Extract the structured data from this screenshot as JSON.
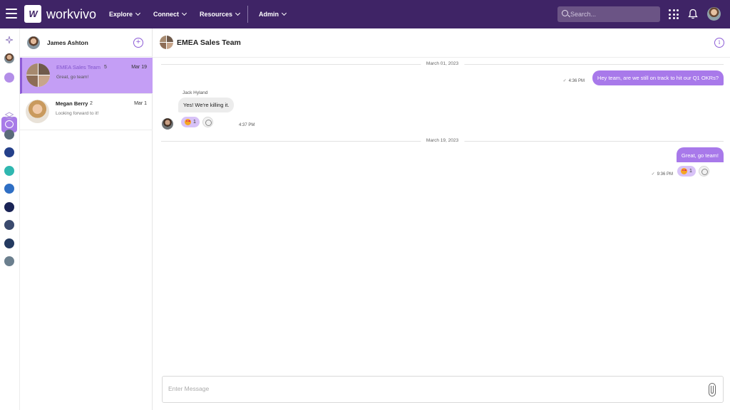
{
  "app": {
    "brand": "workvivo"
  },
  "nav": {
    "items": [
      {
        "label": "Explore"
      },
      {
        "label": "Connect"
      },
      {
        "label": "Resources"
      },
      {
        "label": "Admin"
      }
    ]
  },
  "search": {
    "placeholder": "Search..."
  },
  "colors": {
    "topbar": "#3f2466",
    "accent": "#8c5bd6",
    "active_conversation": "#c49ef5",
    "outgoing_bubble": "#a879ea"
  },
  "icons": {
    "top": [
      "menu-icon",
      "apps-grid-icon",
      "bell-icon"
    ],
    "rail": [
      "sparkle-icon",
      "avatar",
      "compass-icon",
      "chat-icon",
      "layers-icon"
    ]
  },
  "conversations_panel": {
    "user_name": "James Ashton",
    "items": [
      {
        "name": "EMEA Sales Team",
        "count": "5",
        "date": "Mar 19",
        "preview": "Great, go team!",
        "active": true
      },
      {
        "name": "Megan Berry",
        "count": "2",
        "date": "Mar 1",
        "preview": "Looking forward to it!",
        "active": false
      }
    ]
  },
  "chat": {
    "title": "EMEA Sales Team",
    "dates": [
      "March 01, 2023",
      "March 19, 2023"
    ],
    "messages": [
      {
        "direction": "out",
        "text": "Hey team, are we still on track to hit our Q1 OKRs?",
        "time": "4:36 PM"
      },
      {
        "direction": "in",
        "sender": "Jack Hyland",
        "text": "Yes! We're killing it.",
        "time": "4:37 PM",
        "reaction_count": "1"
      },
      {
        "direction": "out",
        "text": "Great, go team!",
        "time": "9:36 PM",
        "reaction_count": "1"
      }
    ],
    "composer_placeholder": "Enter Message"
  }
}
